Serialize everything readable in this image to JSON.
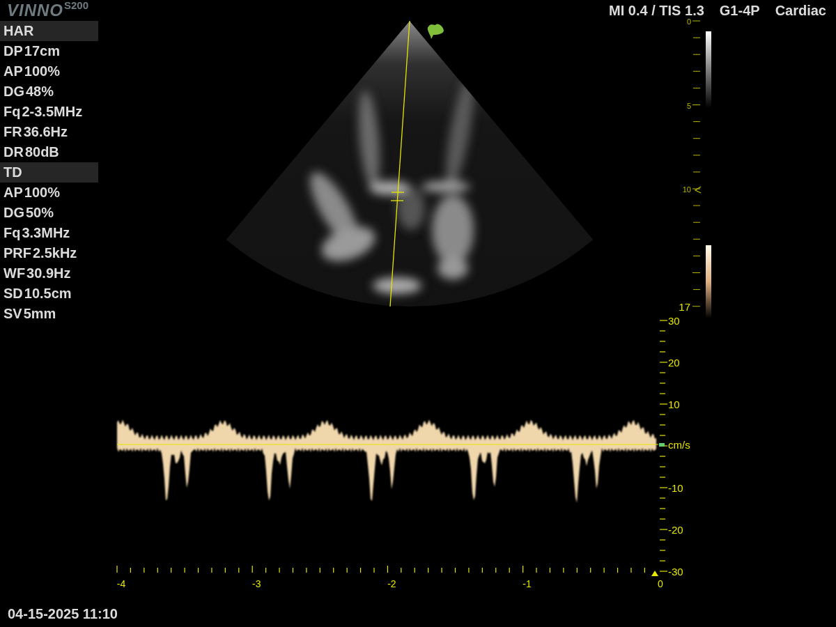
{
  "logo": {
    "brand": "VINNO",
    "model": "S200"
  },
  "top_bar": {
    "output": "MI 0.4 / TIS 1.3",
    "probe": "G1-4P",
    "preset": "Cardiac"
  },
  "parameters": [
    {
      "kind": "header",
      "label": "HAR"
    },
    {
      "kind": "reading",
      "label": "DP",
      "value": "17cm"
    },
    {
      "kind": "reading",
      "label": "AP",
      "value": "100%"
    },
    {
      "kind": "reading",
      "label": "DG",
      "value": "48%"
    },
    {
      "kind": "reading",
      "label": "Fq",
      "value": "2-3.5MHz"
    },
    {
      "kind": "reading",
      "label": "FR",
      "value": "36.6Hz"
    },
    {
      "kind": "reading",
      "label": "DR",
      "value": "80dB"
    },
    {
      "kind": "header",
      "label": "TD"
    },
    {
      "kind": "reading",
      "label": "AP",
      "value": "100%"
    },
    {
      "kind": "reading",
      "label": "DG",
      "value": "50%"
    },
    {
      "kind": "reading",
      "label": "Fq",
      "value": "3.3MHz"
    },
    {
      "kind": "reading",
      "label": "PRF",
      "value": "2.5kHz"
    },
    {
      "kind": "reading",
      "label": "WF",
      "value": "30.9Hz"
    },
    {
      "kind": "reading",
      "label": "SD",
      "value": "10.5cm"
    },
    {
      "kind": "reading",
      "label": "SV",
      "value": "5mm"
    }
  ],
  "depth_scale": {
    "labels": [
      "0",
      "5",
      "10",
      "17"
    ]
  },
  "velocity_scale": {
    "labels": [
      "30",
      "20",
      "10",
      "-10",
      "-20",
      "-30"
    ],
    "unit": "cm/s"
  },
  "time_axis": {
    "labels": [
      "-4",
      "-3",
      "-2",
      "-1",
      "0"
    ]
  },
  "datetime": "04-15-2025 11:10"
}
